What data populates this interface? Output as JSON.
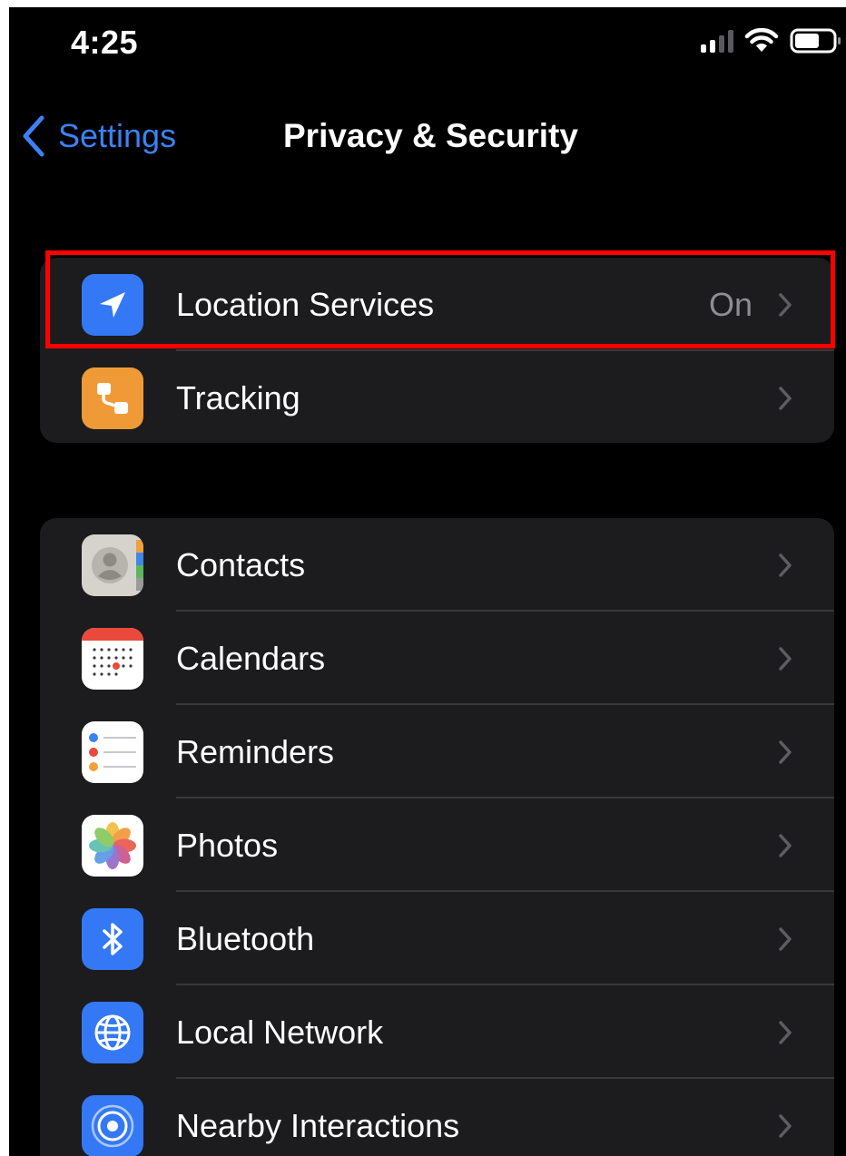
{
  "status_bar": {
    "time": "4:25",
    "icons": [
      "cellular-signal-icon",
      "wifi-icon",
      "battery-icon"
    ]
  },
  "nav": {
    "back_label": "Settings",
    "title": "Privacy & Security"
  },
  "group1": {
    "items": [
      {
        "label": "Location Services",
        "value": "On",
        "icon": "location-arrow-icon",
        "color": "#3478f6"
      },
      {
        "label": "Tracking",
        "value": "",
        "icon": "tracking-icon",
        "color": "#f09a37"
      }
    ]
  },
  "group2": {
    "items": [
      {
        "label": "Contacts",
        "icon": "contacts-icon"
      },
      {
        "label": "Calendars",
        "icon": "calendar-icon"
      },
      {
        "label": "Reminders",
        "icon": "reminders-icon"
      },
      {
        "label": "Photos",
        "icon": "photos-icon"
      },
      {
        "label": "Bluetooth",
        "icon": "bluetooth-icon",
        "color": "#3478f6"
      },
      {
        "label": "Local Network",
        "icon": "globe-icon",
        "color": "#3478f6"
      },
      {
        "label": "Nearby Interactions",
        "icon": "nearby-icon",
        "color": "#3478f6"
      }
    ]
  },
  "colors": {
    "accent": "#3b82f6",
    "highlight": "#ff0000",
    "background": "#000000",
    "cell": "#1c1c1e"
  }
}
